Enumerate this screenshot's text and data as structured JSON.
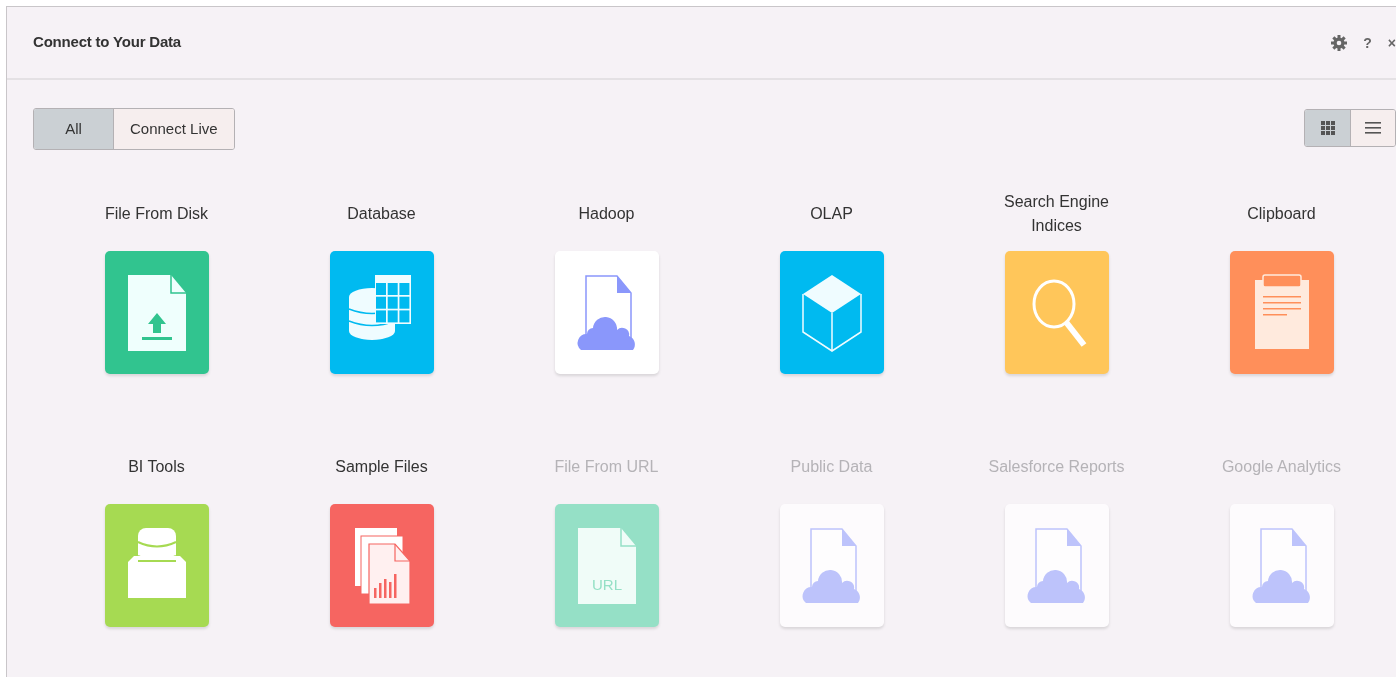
{
  "window": {
    "title": "Connect to Your Data",
    "help": "?",
    "close": "×"
  },
  "filters": [
    {
      "label": "All",
      "selected": true
    },
    {
      "label": "Connect Live",
      "selected": false
    }
  ],
  "views": [
    {
      "kind": "grid",
      "selected": true
    },
    {
      "kind": "list",
      "selected": false
    }
  ],
  "sources": [
    {
      "label": "File From Disk",
      "kind": "upload-file",
      "color": "#31c48f",
      "disabled": false
    },
    {
      "label": "Database",
      "kind": "database-grid",
      "color": "#00baf0",
      "disabled": false
    },
    {
      "label": "Hadoop",
      "kind": "cloud-file",
      "color": "#ffffff",
      "disabled": false
    },
    {
      "label": "OLAP",
      "kind": "cube",
      "color": "#00baf0",
      "disabled": false
    },
    {
      "label": "Search Engine Indices",
      "kind": "search",
      "color": "#ffc65a",
      "disabled": false
    },
    {
      "label": "Clipboard",
      "kind": "clipboard",
      "color": "#ff8f5a",
      "disabled": false
    },
    {
      "label": "BI Tools",
      "kind": "database-box",
      "color": "#a6da52",
      "disabled": false
    },
    {
      "label": "Sample Files",
      "kind": "sample-files",
      "color": "#f66561",
      "disabled": false
    },
    {
      "label": "File From URL",
      "kind": "url-file",
      "color": "#95e0c6",
      "disabled": true,
      "icon_text": "URL"
    },
    {
      "label": "Public Data",
      "kind": "cloud-file",
      "color": "#fdfbfd",
      "disabled": true
    },
    {
      "label": "Salesforce Reports",
      "kind": "cloud-file",
      "color": "#fdfbfd",
      "disabled": true
    },
    {
      "label": "Google Analytics",
      "kind": "cloud-file",
      "color": "#fdfbfd",
      "disabled": true
    }
  ]
}
